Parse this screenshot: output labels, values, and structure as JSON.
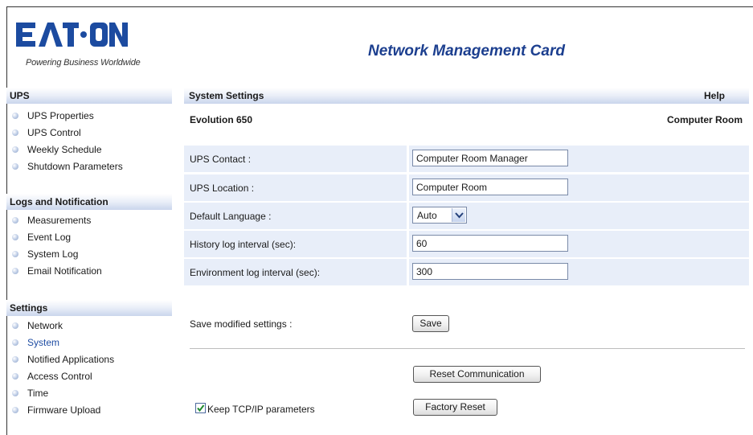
{
  "brand": {
    "logo_text": "EATON",
    "tagline": "Powering Business Worldwide",
    "logo_color": "#1c4ba0"
  },
  "app_title": "Network Management Card",
  "sidebar": {
    "sections": [
      {
        "title": "UPS",
        "items": [
          {
            "label": "UPS Properties"
          },
          {
            "label": "UPS Control"
          },
          {
            "label": "Weekly Schedule"
          },
          {
            "label": "Shutdown Parameters"
          }
        ]
      },
      {
        "title": "Logs and Notification",
        "items": [
          {
            "label": "Measurements"
          },
          {
            "label": "Event Log"
          },
          {
            "label": "System Log"
          },
          {
            "label": "Email Notification"
          }
        ]
      },
      {
        "title": "Settings",
        "items": [
          {
            "label": "Network"
          },
          {
            "label": "System",
            "active": true
          },
          {
            "label": "Notified Applications"
          },
          {
            "label": "Access Control"
          },
          {
            "label": "Time"
          },
          {
            "label": "Firmware Upload"
          }
        ]
      }
    ]
  },
  "main": {
    "title": "System Settings",
    "help": "Help",
    "model": "Evolution 650",
    "room": "Computer Room",
    "fields": {
      "ups_contact": {
        "label": "UPS Contact :",
        "value": "Computer Room Manager"
      },
      "ups_location": {
        "label": "UPS Location :",
        "value": "Computer Room"
      },
      "default_language": {
        "label": "Default Language :",
        "value": "Auto"
      },
      "history_interval": {
        "label": "History log interval (sec):",
        "value": "60"
      },
      "environment_interval": {
        "label": "Environment log interval (sec):",
        "value": "300"
      }
    },
    "save_label": "Save modified settings :",
    "save_button": "Save",
    "reset_comm_button": "Reset Communication",
    "keep_tcpip_label": "Keep TCP/IP parameters",
    "keep_tcpip_checked": true,
    "factory_reset_button": "Factory Reset"
  },
  "colors": {
    "accent": "#1c3f8f",
    "row_background": "#e8eef9",
    "header_gradient": "#c9d5ec"
  }
}
